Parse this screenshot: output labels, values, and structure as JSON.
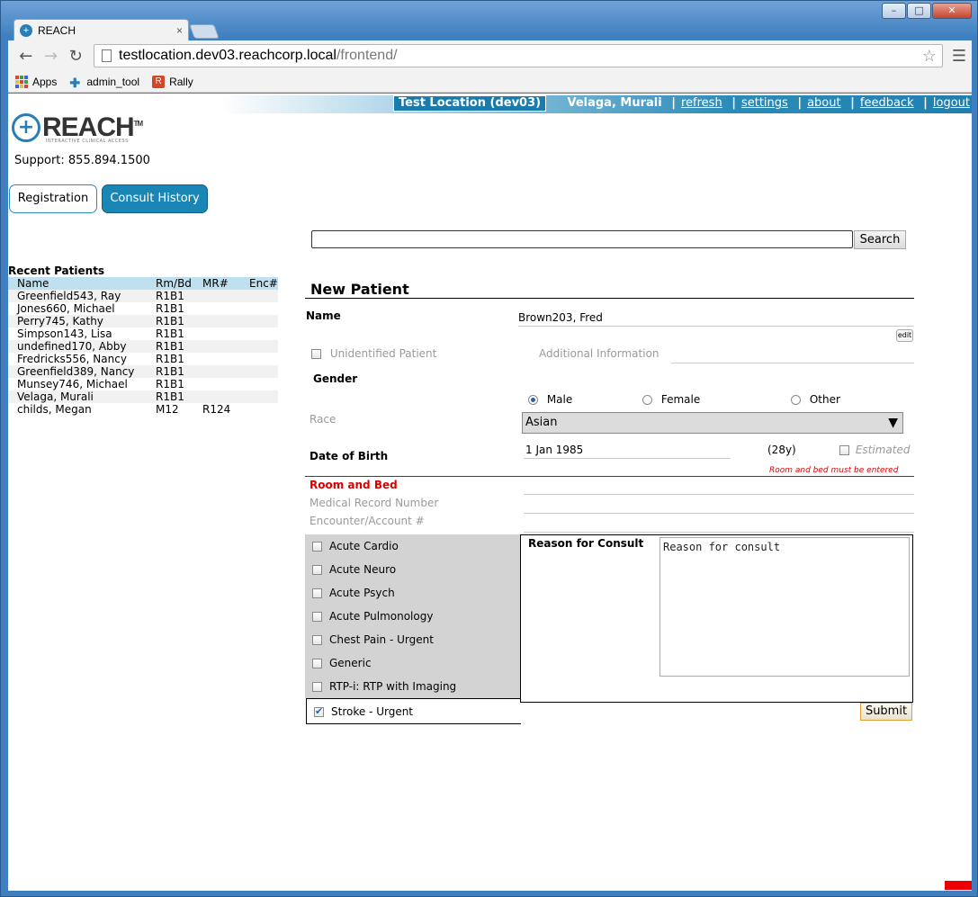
{
  "browser": {
    "tab_title": "REACH",
    "tab_close": "×",
    "url_host": "testlocation.dev03.reachcorp.local",
    "url_path": "/frontend/",
    "bookmarks": [
      "Apps",
      "admin_tool",
      "Rally"
    ]
  },
  "header": {
    "location": "Test Location (dev03)",
    "user": "Velaga, Murali",
    "links": [
      "refresh",
      "settings",
      "about",
      "feedback",
      "logout"
    ],
    "separator": "|"
  },
  "logo": {
    "word": "REACH",
    "tm": "TM",
    "tagline": "INTERACTIVE CLINICAL ACCESS"
  },
  "support": "Support: 855.894.1500",
  "nav": {
    "registration": "Registration",
    "consult_history": "Consult History"
  },
  "search": {
    "value": "",
    "button": "Search"
  },
  "recent_patients": {
    "title": "Recent Patients",
    "columns": [
      "Name",
      "Rm/Bd",
      "MR#",
      "Enc#"
    ],
    "rows": [
      [
        "Greenfield543, Ray",
        "R1B1",
        "",
        ""
      ],
      [
        "Jones660, Michael",
        "R1B1",
        "",
        ""
      ],
      [
        "Perry745, Kathy",
        "R1B1",
        "",
        ""
      ],
      [
        "Simpson143, Lisa",
        "R1B1",
        "",
        ""
      ],
      [
        "undefined170, Abby",
        "R1B1",
        "",
        ""
      ],
      [
        "Fredricks556, Nancy",
        "R1B1",
        "",
        ""
      ],
      [
        "Greenfield389, Nancy",
        "R1B1",
        "",
        ""
      ],
      [
        "Munsey746, Michael",
        "R1B1",
        "",
        ""
      ],
      [
        "Velaga, Murali",
        "R1B1",
        "",
        ""
      ],
      [
        "childs, Megan",
        "M12",
        "R124",
        ""
      ]
    ]
  },
  "form": {
    "title": "New Patient",
    "name_label": "Name",
    "name_value": "Brown203, Fred",
    "edit": "edit",
    "unidentified": "Unidentified Patient",
    "additional_info": "Additional Information",
    "gender_label": "Gender",
    "gender_options": [
      "Male",
      "Female",
      "Other"
    ],
    "gender_selected": "Male",
    "race_label": "Race",
    "race_value": "Asian",
    "dob_label": "Date of Birth",
    "dob_value": "1 Jan 1985",
    "age": "(28y)",
    "estimated": "Estimated",
    "room_bed_error": "Room and bed must be entered",
    "room_bed_label": "Room and Bed",
    "mrn_label": "Medical Record Number",
    "encounter_label": "Encounter/Account #"
  },
  "consult": {
    "types": [
      "Acute Cardio",
      "Acute Neuro",
      "Acute Psych",
      "Acute Pulmonology",
      "Chest Pain - Urgent",
      "Generic",
      "RTP-i: RTP with Imaging"
    ],
    "selected_type": "Stroke - Urgent",
    "reason_label": "Reason for Consult",
    "reason_placeholder": "Reason for consult",
    "submit": "Submit"
  },
  "colors": {
    "accent": "#1a86b6",
    "error": "#dd0000",
    "header_bg": "#1f7fb0"
  }
}
